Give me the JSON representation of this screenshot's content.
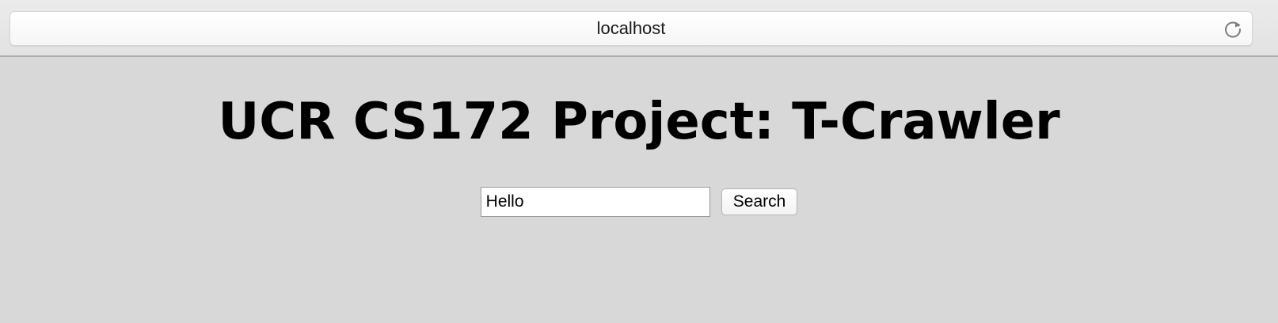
{
  "browser": {
    "address": "localhost",
    "reload_icon": "reload-icon"
  },
  "page": {
    "title": "UCR CS172 Project: T-Crawler",
    "search": {
      "value": "Hello",
      "button_label": "Search"
    }
  },
  "colors": {
    "page_background": "#d8d8d8",
    "toolbar_background": "#ecebec",
    "text": "#000000"
  }
}
